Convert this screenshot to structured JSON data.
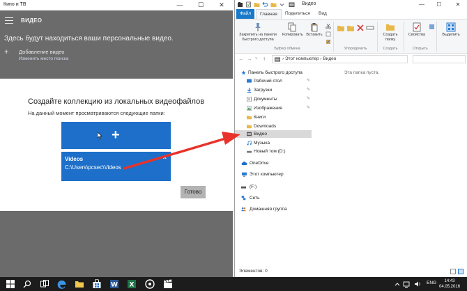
{
  "movies_app": {
    "window_title": "Кино и ТВ",
    "page_title": "ВИДЕО",
    "intro_text": "Здесь будут находиться ваши персональные видео.",
    "add_video_label": "Добавление видео",
    "change_search_link": "Изменить место поиска",
    "dialog": {
      "title": "Создайте коллекцию из локальных видеофайлов",
      "subtitle": "На данный момент просматриваются следующие папки:",
      "add_tile_symbol": "+",
      "folder_name": "Videos",
      "folder_path": "C:\\Users\\pcsec\\Videos",
      "remove_symbol": "×",
      "done_label": "Готово"
    },
    "window_buttons": {
      "minimize": "—",
      "maximize": "☐",
      "close": "✕"
    }
  },
  "explorer": {
    "window_title": "Видео",
    "window_buttons": {
      "minimize": "—",
      "maximize": "☐",
      "close": "✕"
    },
    "tabs": [
      {
        "label": "Файл",
        "style": "file"
      },
      {
        "label": "Главная",
        "style": "active"
      },
      {
        "label": "Поделиться",
        "style": ""
      },
      {
        "label": "Вид",
        "style": ""
      }
    ],
    "ribbon": {
      "pin_label": "Закрепить на панели быстрого доступа",
      "copy_label": "Копировать",
      "paste_label": "Вставить",
      "new_folder_label": "Создать папку",
      "properties_label": "Свойства",
      "select_label": "Выделить",
      "groups": {
        "clipboard": "Буфер обмена",
        "organize": "Упорядочить",
        "create": "Создать",
        "open": "Открыть"
      }
    },
    "address": {
      "separator": "›",
      "segments": [
        "Этот компьютер",
        "Видео"
      ]
    },
    "nav_items": [
      {
        "label": "Панель быстрого доступа",
        "icon": "star-icon",
        "pinned": false
      },
      {
        "label": "Рабочий стол",
        "icon": "desktop-icon",
        "pinned": true
      },
      {
        "label": "Загрузки",
        "icon": "downloads-icon",
        "pinned": true
      },
      {
        "label": "Документы",
        "icon": "documents-icon",
        "pinned": true
      },
      {
        "label": "Изображения",
        "icon": "pictures-icon",
        "pinned": true
      },
      {
        "label": "Книги",
        "icon": "folder-icon",
        "pinned": false
      },
      {
        "label": "Downloads",
        "icon": "folder-icon",
        "pinned": false
      },
      {
        "label": "Видео",
        "icon": "videos-icon",
        "pinned": false,
        "selected": true
      },
      {
        "label": "Музыка",
        "icon": "music-icon",
        "pinned": false
      },
      {
        "label": "Новый том (D:)",
        "icon": "drive-icon",
        "pinned": false
      },
      {
        "label": "OneDrive",
        "icon": "onedrive-icon",
        "pinned": false
      },
      {
        "label": "Этот компьютер",
        "icon": "computer-icon",
        "pinned": false
      },
      {
        "label": "(F:)",
        "icon": "drive-icon",
        "pinned": false
      },
      {
        "label": "Сеть",
        "icon": "network-icon",
        "pinned": false
      },
      {
        "label": "Домашняя группа",
        "icon": "homegroup-icon",
        "pinned": false
      }
    ],
    "empty_text": "Эта папка пуста.",
    "status_text": "Элементов: 0"
  },
  "taskbar": {
    "language": "ENG",
    "time": "14:43",
    "date": "04.05.2016"
  },
  "colors": {
    "accent_blue": "#1d6fc9",
    "arrow_red": "#e8332a",
    "app_dim": "#6b6b6b",
    "taskbar": "#1c1c1c"
  }
}
